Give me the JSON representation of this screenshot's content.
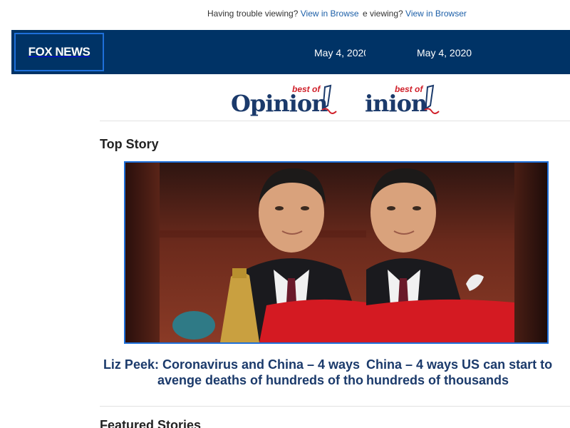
{
  "preheader": {
    "trouble_text": "Having trouble viewing?",
    "trouble_text_fragment": "e viewing?",
    "view_link": "View in Browser",
    "view_link_fragment": "View in Browse"
  },
  "header": {
    "logo_text": "FOX NEWS",
    "date": "May 4, 2020",
    "date_fragment": "May 4, 202"
  },
  "opinion_banner": {
    "best_of": "best of",
    "word": "Opinion",
    "word_fragment": "inion"
  },
  "top_story": {
    "section_title": "Top Story",
    "headline_line1": "Liz Peek: Coronavirus and China – 4 ways",
    "headline_line2": "avenge deaths of hundreds of tho",
    "headline_dup_line1": "China – 4 ways US can start to",
    "headline_dup_line2": "hundreds of thousands"
  },
  "featured": {
    "section_title": "Featured Stories"
  },
  "colors": {
    "header_bg": "#003366",
    "link": "#1c5fa8",
    "headline": "#1b3a6b",
    "accent_border": "#1e6fd9",
    "best_of_red": "#d0202a"
  }
}
